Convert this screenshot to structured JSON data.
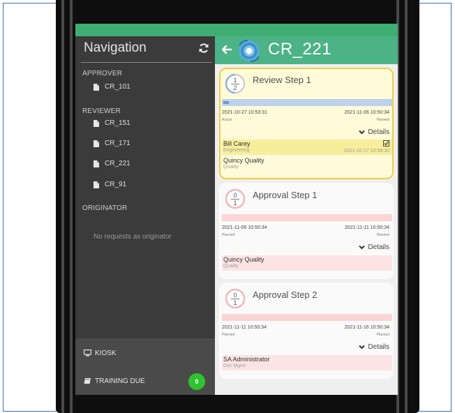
{
  "nav": {
    "title": "Navigation",
    "sections": {
      "approver": "APPROVER",
      "reviewer": "REVIEWER",
      "originator": "ORIGINATOR"
    },
    "approver_items": [
      "CR_101"
    ],
    "reviewer_items": [
      "CR_151",
      "CR_171",
      "CR_221",
      "CR_91"
    ],
    "originator_empty": "No requests as originator",
    "kiosk": "KIOSK",
    "training_due": "TRAINING DUE",
    "training_count": "0"
  },
  "header": {
    "title": "CR_221"
  },
  "steps": [
    {
      "title": "Review Step 1",
      "fraction_top": "1",
      "fraction_bottom": "2",
      "start_date": "2021-10-27 10:53:31",
      "start_label": "Actual",
      "end_date": "2021-11-06 10:50:34",
      "end_label": "Planned",
      "details": "Details",
      "people": [
        {
          "name": "Bill Carey",
          "dept": "Engineering",
          "date": "2021-10-27 10:56:30"
        },
        {
          "name": "Quincy Quality",
          "dept": "Quality"
        }
      ]
    },
    {
      "title": "Approval Step 1",
      "fraction_top": "0",
      "fraction_bottom": "1",
      "start_date": "2021-11-06 10:50:34",
      "start_label": "Planned",
      "end_date": "2021-11-11 10:50:34",
      "end_label": "Planned",
      "details": "Details",
      "people": [
        {
          "name": "Quincy Quality",
          "dept": "Quality"
        }
      ]
    },
    {
      "title": "Approval Step 2",
      "fraction_top": "0",
      "fraction_bottom": "1",
      "start_date": "2021-11-11 10:50:34",
      "start_label": "Planned",
      "end_date": "2021-11-16 10:50:34",
      "end_label": "Planned",
      "details": "Details",
      "people": [
        {
          "name": "SA Administrator",
          "dept": "Doc Mgmt"
        }
      ]
    }
  ],
  "colors": {
    "accent_green": "#4cb386",
    "active_card": "#fffbd9",
    "active_border": "#f0cc47",
    "pending_bar": "#fbd4d4",
    "progress_bar": "#bcd2ec"
  }
}
